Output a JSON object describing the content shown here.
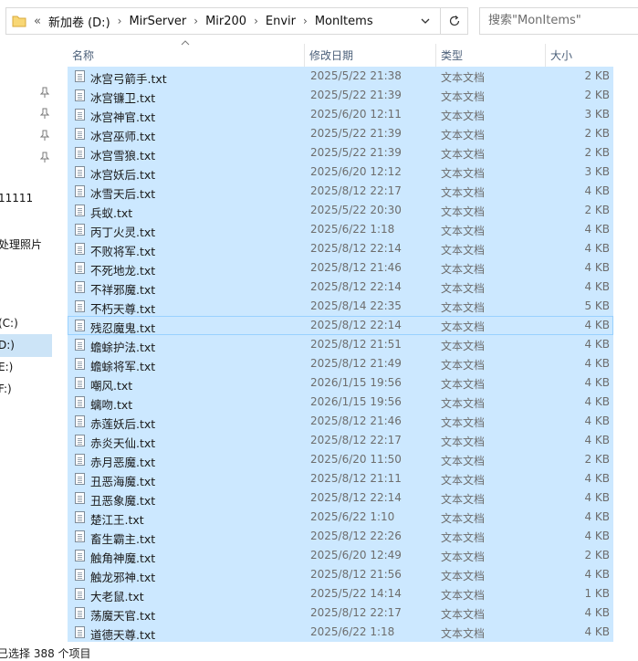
{
  "address": {
    "overflow": "«",
    "crumbs": [
      "新加卷 (D:)",
      "MirServer",
      "Mir200",
      "Envir",
      "MonItems"
    ],
    "separator": "›"
  },
  "search": {
    "placeholder": "搜索\"MonItems\""
  },
  "nav": {
    "items": [
      "11111",
      "处理照片",
      "(C:)",
      "D:)",
      "E:)",
      "F:)"
    ]
  },
  "columns": {
    "name": "名称",
    "date": "修改日期",
    "type": "类型",
    "size": "大小"
  },
  "files": [
    {
      "name": "冰宫弓箭手.txt",
      "date": "2025/5/22 21:38",
      "type": "文本文档",
      "size": "2 KB"
    },
    {
      "name": "冰宫镰卫.txt",
      "date": "2025/5/22 21:39",
      "type": "文本文档",
      "size": "2 KB"
    },
    {
      "name": "冰宫神官.txt",
      "date": "2025/6/20 12:11",
      "type": "文本文档",
      "size": "3 KB"
    },
    {
      "name": "冰宫巫师.txt",
      "date": "2025/5/22 21:39",
      "type": "文本文档",
      "size": "2 KB"
    },
    {
      "name": "冰宫雪狼.txt",
      "date": "2025/5/22 21:39",
      "type": "文本文档",
      "size": "2 KB"
    },
    {
      "name": "冰宫妖后.txt",
      "date": "2025/6/20 12:12",
      "type": "文本文档",
      "size": "3 KB"
    },
    {
      "name": "冰雪天后.txt",
      "date": "2025/8/12 22:17",
      "type": "文本文档",
      "size": "4 KB"
    },
    {
      "name": "兵蚁.txt",
      "date": "2025/5/22 20:30",
      "type": "文本文档",
      "size": "2 KB"
    },
    {
      "name": "丙丁火灵.txt",
      "date": "2025/6/22 1:18",
      "type": "文本文档",
      "size": "4 KB"
    },
    {
      "name": "不败将军.txt",
      "date": "2025/8/12 22:14",
      "type": "文本文档",
      "size": "4 KB"
    },
    {
      "name": "不死地龙.txt",
      "date": "2025/8/12 21:46",
      "type": "文本文档",
      "size": "4 KB"
    },
    {
      "name": "不祥邪魔.txt",
      "date": "2025/8/12 22:14",
      "type": "文本文档",
      "size": "4 KB"
    },
    {
      "name": "不朽天尊.txt",
      "date": "2025/8/14 22:35",
      "type": "文本文档",
      "size": "5 KB"
    },
    {
      "name": "残忍魔鬼.txt",
      "date": "2025/8/12 22:14",
      "type": "文本文档",
      "size": "4 KB"
    },
    {
      "name": "蟾蜍护法.txt",
      "date": "2025/8/12 21:51",
      "type": "文本文档",
      "size": "4 KB"
    },
    {
      "name": "蟾蜍将军.txt",
      "date": "2025/8/12 21:49",
      "type": "文本文档",
      "size": "4 KB"
    },
    {
      "name": "嘲风.txt",
      "date": "2026/1/15 19:56",
      "type": "文本文档",
      "size": "4 KB"
    },
    {
      "name": "螭吻.txt",
      "date": "2026/1/15 19:56",
      "type": "文本文档",
      "size": "4 KB"
    },
    {
      "name": "赤莲妖后.txt",
      "date": "2025/8/12 21:46",
      "type": "文本文档",
      "size": "4 KB"
    },
    {
      "name": "赤炎天仙.txt",
      "date": "2025/8/12 22:17",
      "type": "文本文档",
      "size": "4 KB"
    },
    {
      "name": "赤月恶魔.txt",
      "date": "2025/6/20 11:50",
      "type": "文本文档",
      "size": "2 KB"
    },
    {
      "name": "丑恶海魔.txt",
      "date": "2025/8/12 21:11",
      "type": "文本文档",
      "size": "4 KB"
    },
    {
      "name": "丑恶象魔.txt",
      "date": "2025/8/12 22:14",
      "type": "文本文档",
      "size": "4 KB"
    },
    {
      "name": "楚江王.txt",
      "date": "2025/6/22 1:10",
      "type": "文本文档",
      "size": "4 KB"
    },
    {
      "name": "畜生霸主.txt",
      "date": "2025/8/12 22:26",
      "type": "文本文档",
      "size": "4 KB"
    },
    {
      "name": "触角神魔.txt",
      "date": "2025/6/20 12:49",
      "type": "文本文档",
      "size": "2 KB"
    },
    {
      "name": "触龙邪神.txt",
      "date": "2025/8/12 21:56",
      "type": "文本文档",
      "size": "4 KB"
    },
    {
      "name": "大老鼠.txt",
      "date": "2025/5/22 14:14",
      "type": "文本文档",
      "size": "1 KB"
    },
    {
      "name": "荡魔天官.txt",
      "date": "2025/8/12 22:17",
      "type": "文本文档",
      "size": "4 KB"
    },
    {
      "name": "道德天尊.txt",
      "date": "2025/6/22 1:18",
      "type": "文本文档",
      "size": "4 KB"
    }
  ],
  "status": {
    "text": "已选择 388 个项目"
  }
}
